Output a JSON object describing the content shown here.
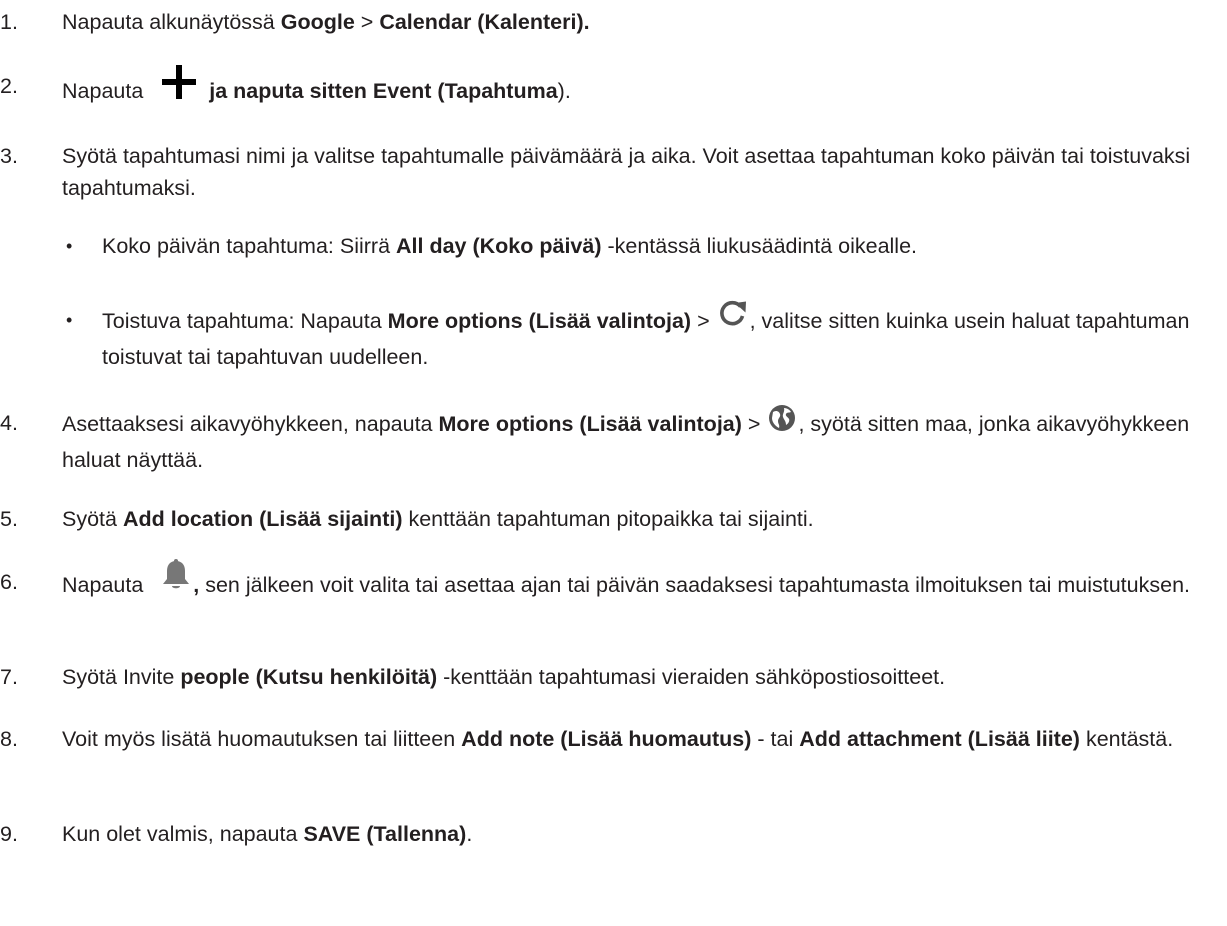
{
  "steps": [
    {
      "num": "1.",
      "t1": "Napauta alkunäytössä ",
      "b1": "Google",
      "t2": " > ",
      "b2": "Calendar (Kalenteri)."
    },
    {
      "num": "2.",
      "t1": "Napauta ",
      "icon": "plus-icon",
      "b1": " ja naputa sitten Event (Tapahtuma",
      "t2": ")."
    },
    {
      "num": "3.",
      "t1": "Syötä tapahtumasi nimi ja valitse tapahtumalle päivämäärä ja aika. Voit asettaa tapahtuman koko päivän tai toistuvaksi tapahtumaksi."
    },
    {
      "num": "4.",
      "t1": "Asettaaksesi aikavyöhykkeen, napauta ",
      "b1": "More options (Lisää valintoja)",
      "t2": " > ",
      "icon": "globe-icon",
      "t3": ", syötä sitten maa, jonka aikavyöhykkeen haluat näyttää."
    },
    {
      "num": "5.",
      "t1": "Syötä ",
      "b1": "Add location (Lisää sijainti)",
      "t2": " kenttään tapahtuman pitopaikka tai sijainti."
    },
    {
      "num": "6.",
      "t1": "Napauta ",
      "icon": "bell-icon",
      "b1": ",",
      "t2": " sen jälkeen voit valita tai asettaa ajan tai päivän saadaksesi tapahtumasta ilmoituksen tai muistutuksen."
    },
    {
      "num": "7.",
      "t1": "Syötä Invite ",
      "b1": "people (Kutsu henkilöitä)",
      "t2": " -kenttään tapahtumasi vieraiden sähköpostiosoitteet."
    },
    {
      "num": "8.",
      "t1": "Voit myös lisätä huomautuksen tai liitteen ",
      "b1": "Add note (Lisää huomautus)",
      "t2": " - tai ",
      "b2": "Add attachment (Lisää liite)",
      "t3": " kentästä."
    },
    {
      "num": "9.",
      "t1": "Kun olet valmis, napauta ",
      "b1": "SAVE (Tallenna)",
      "t2": "."
    }
  ],
  "substeps": [
    {
      "bullet": "•",
      "t1": "Koko päivän tapahtuma: Siirrä ",
      "b1": "All day (Koko päivä)",
      "t2": " -kentässä liukusäädintä oikealle."
    },
    {
      "bullet": "•",
      "t1": "Toistuva tapahtuma: Napauta ",
      "b1": "More options (Lisää valintoja)",
      "t2": " > ",
      "icon": "refresh-icon",
      "t3": ", valitse sitten kuinka usein haluat tapahtuman toistuvat tai tapahtuvan uudelleen."
    }
  ]
}
